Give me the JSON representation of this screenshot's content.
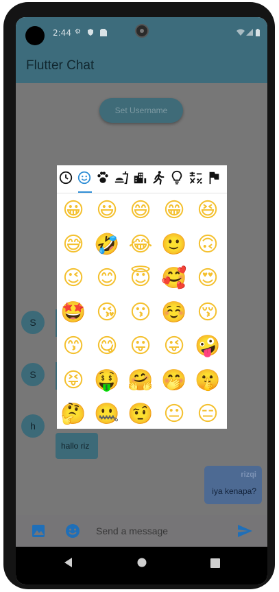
{
  "status_bar": {
    "time": "2:44"
  },
  "app_bar": {
    "title": "Flutter Chat"
  },
  "set_username_button": "Set Username",
  "avatars": [
    "S",
    "S",
    "h"
  ],
  "messages": {
    "incoming": {
      "text": "hallo riz"
    },
    "outgoing": {
      "sender": "rizqi",
      "text": "iya kenapa?"
    }
  },
  "composer": {
    "placeholder": "Send a message"
  },
  "emoji_picker": {
    "tabs": [
      "recent-icon",
      "smileys-icon",
      "animals-icon",
      "food-icon",
      "travel-icon",
      "activities-icon",
      "objects-icon",
      "symbols-icon",
      "flags-icon"
    ],
    "selected_tab": "smileys-icon",
    "accent": "#2f8ed6",
    "emojis": [
      "😀",
      "😃",
      "😄",
      "😁",
      "😆",
      "😅",
      "🤣",
      "😂",
      "🙂",
      "🙃",
      "😉",
      "😊",
      "😇",
      "🥰",
      "😍",
      "🤩",
      "😘",
      "😗",
      "☺️",
      "😚",
      "😙",
      "😋",
      "😛",
      "😜",
      "🤪",
      "😝",
      "🤑",
      "🤗",
      "🤭",
      "🤫",
      "🤔",
      "🤐",
      "🤨",
      "😐",
      "😑"
    ]
  },
  "colors": {
    "app_bar": "#3d6c7c",
    "scrim": "#777777",
    "outgoing_bubble": "#4d6a93",
    "send": "#1f6fb8"
  }
}
